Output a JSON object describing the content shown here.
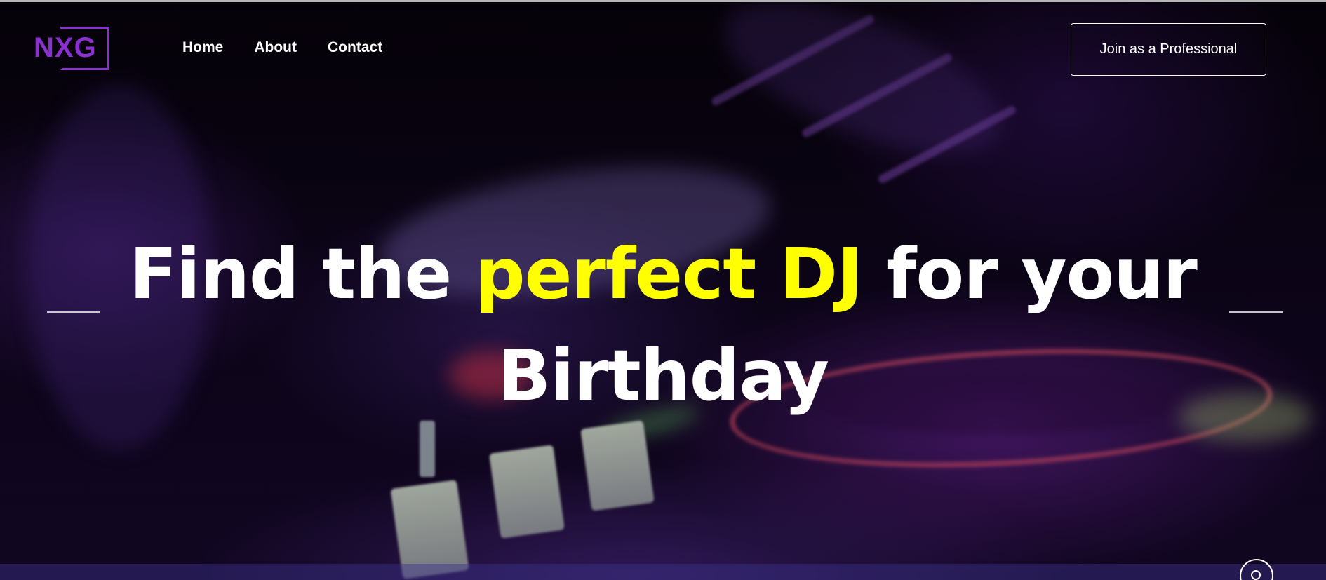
{
  "brand": {
    "logo_text": "NXG",
    "color": "#8a2fd0"
  },
  "nav": {
    "items": [
      {
        "label": "Home"
      },
      {
        "label": "About"
      },
      {
        "label": "Contact"
      }
    ]
  },
  "header": {
    "cta_label": "Join as a Professional"
  },
  "hero": {
    "headline_pre": "Find the ",
    "headline_highlight": "perfect DJ",
    "headline_post": " for your Birthday",
    "highlight_color": "#ffff00",
    "text_color": "#ffffff"
  },
  "carousel": {
    "prev_icon": "line-left-arrow-icon",
    "next_icon": "line-right-arrow-icon"
  },
  "widgets": {
    "scroll_icon": "circle-scroll-icon"
  }
}
